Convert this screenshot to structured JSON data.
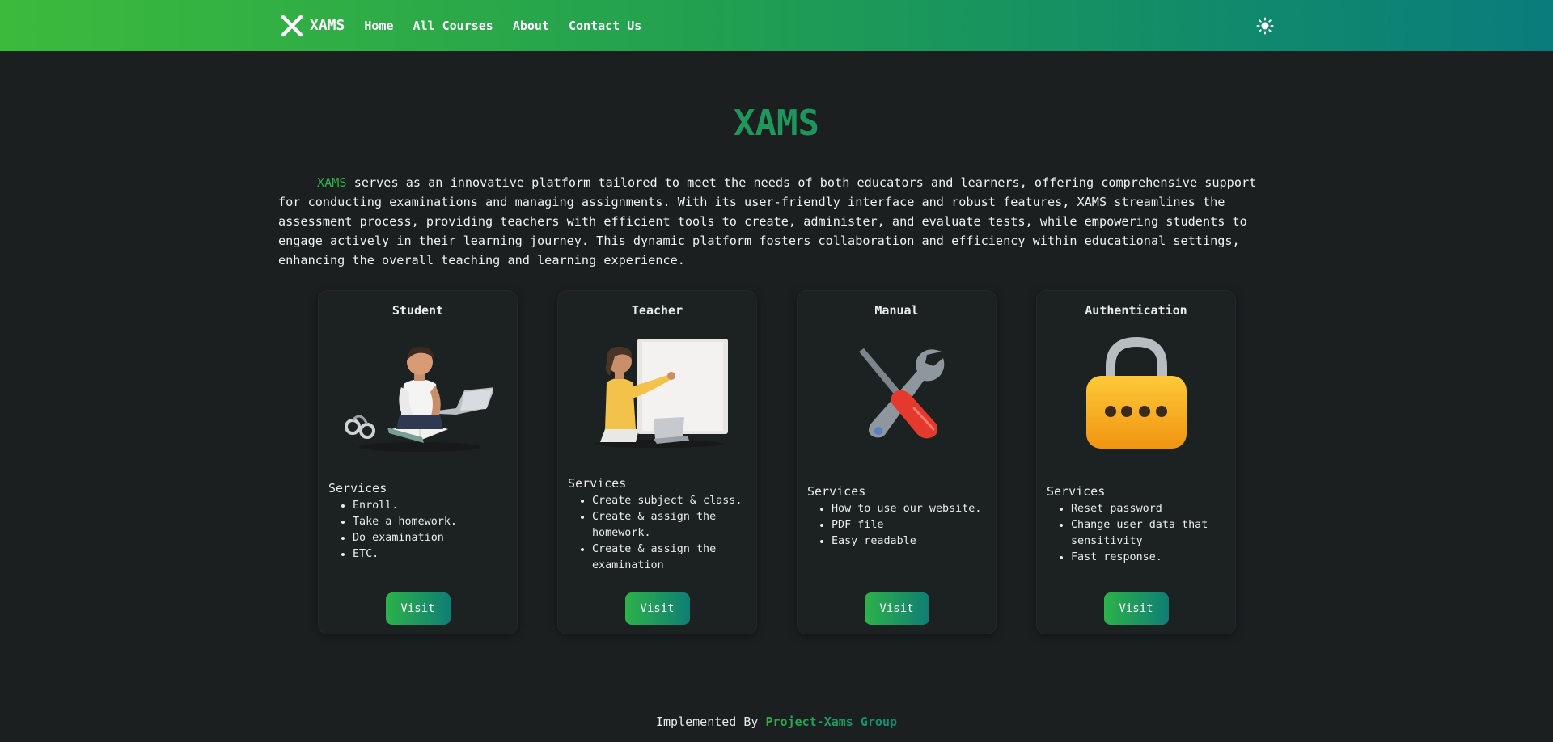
{
  "nav": {
    "brand": "XAMS",
    "links": [
      "Home",
      "All Courses",
      "About",
      "Contact Us"
    ],
    "theme_icon": "sun-icon"
  },
  "hero": {
    "title": "XAMS",
    "intro_accent": "XAMS",
    "intro_text": " serves as an innovative platform tailored to meet the needs of both educators and learners, offering comprehensive support for conducting examinations and managing assignments. With its user-friendly interface and robust features, XAMS streamlines the assessment process, providing teachers with efficient tools to create, administer, and evaluate tests, while empowering students to engage actively in their learning journey. This dynamic platform fosters collaboration and efficiency within educational settings, enhancing the overall teaching and learning experience."
  },
  "cards": [
    {
      "title": "Student",
      "image": "student-illustration",
      "services_heading": "Services",
      "services": [
        "Enroll.",
        "Take a homework.",
        "Do examination",
        "ETC."
      ],
      "button": "Visit"
    },
    {
      "title": "Teacher",
      "image": "teacher-illustration",
      "services_heading": "Services",
      "services": [
        "Create subject & class.",
        "Create & assign the homework.",
        "Create & assign the examination"
      ],
      "button": "Visit"
    },
    {
      "title": "Manual",
      "image": "tools-illustration",
      "services_heading": "Services",
      "services": [
        "How to use our website.",
        "PDF file",
        "Easy readable"
      ],
      "button": "Visit"
    },
    {
      "title": "Authentication",
      "image": "padlock-illustration",
      "services_heading": "Services",
      "services": [
        "Reset password",
        "Change user data that sensitivity",
        "Fast response."
      ],
      "button": "Visit"
    }
  ],
  "footer": {
    "prefix": "Implemented By",
    "group": "Project-Xams Group"
  },
  "colors": {
    "accent_green": "#2fb04a",
    "accent_teal": "#0e7e73",
    "background": "#1b1f20"
  }
}
